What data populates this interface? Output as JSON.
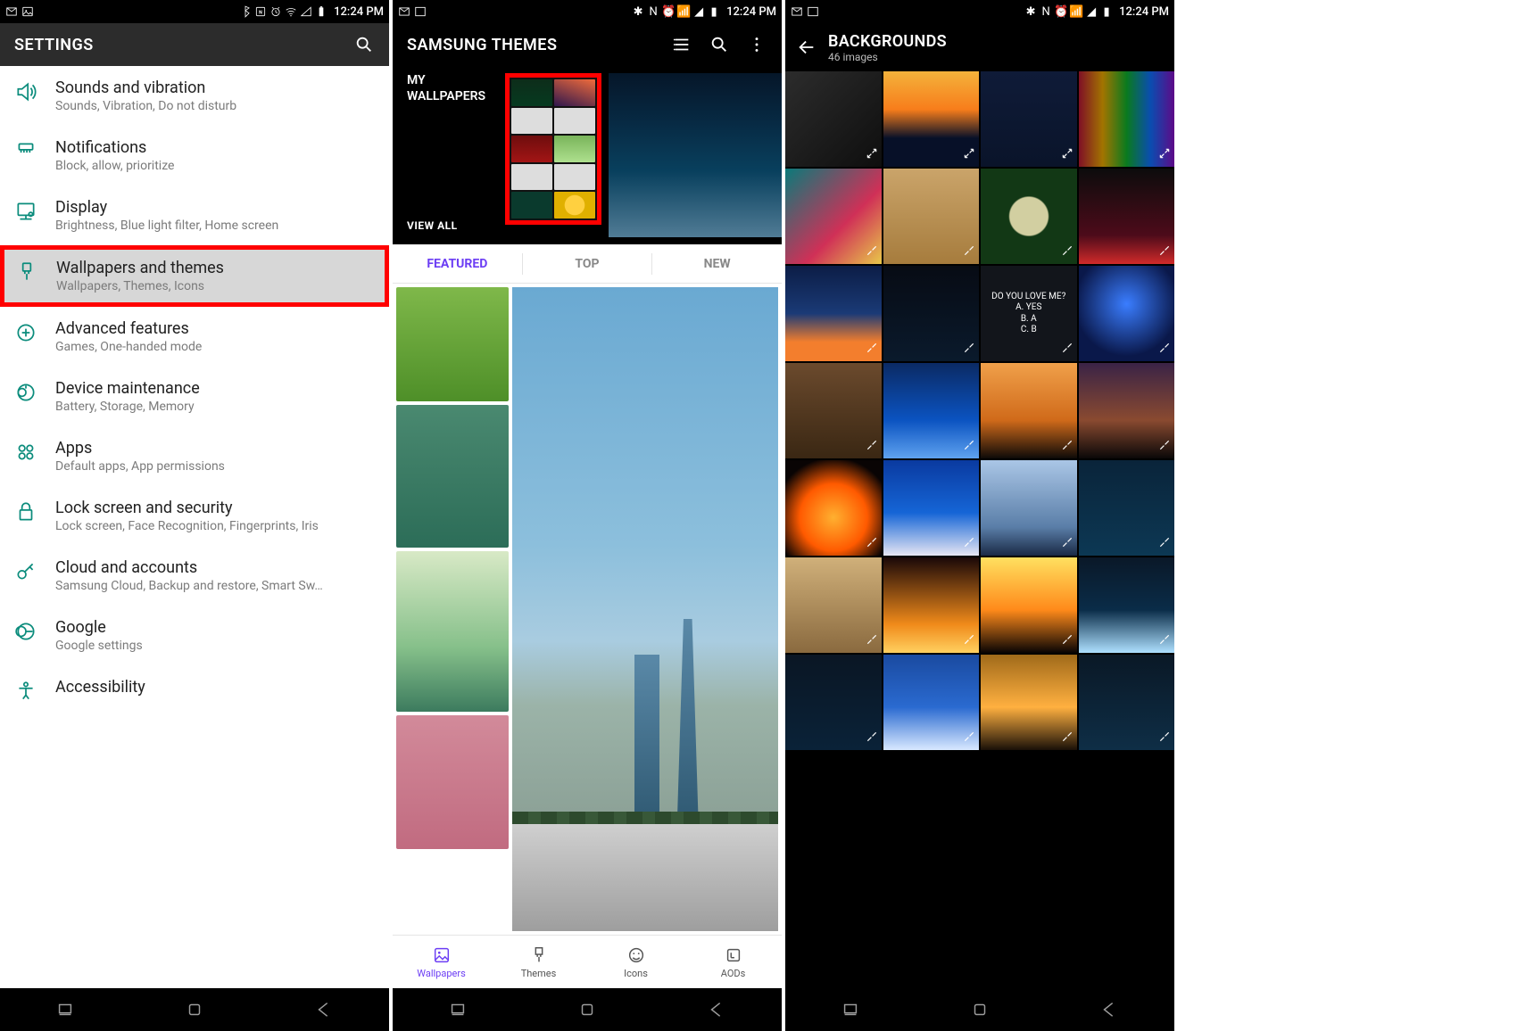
{
  "statusbar": {
    "time": "12:24 PM"
  },
  "phone1": {
    "title": "SETTINGS",
    "items": [
      {
        "title": "Sounds and vibration",
        "sub": "Sounds, Vibration, Do not disturb",
        "icon": "sound"
      },
      {
        "title": "Notifications",
        "sub": "Block, allow, prioritize",
        "icon": "notif"
      },
      {
        "title": "Display",
        "sub": "Brightness, Blue light filter, Home screen",
        "icon": "display"
      },
      {
        "title": "Wallpapers and themes",
        "sub": "Wallpapers, Themes, Icons",
        "icon": "brush",
        "highlight": true
      },
      {
        "title": "Advanced features",
        "sub": "Games, One-handed mode",
        "icon": "plus"
      },
      {
        "title": "Device maintenance",
        "sub": "Battery, Storage, Memory",
        "icon": "maint"
      },
      {
        "title": "Apps",
        "sub": "Default apps, App permissions",
        "icon": "apps"
      },
      {
        "title": "Lock screen and security",
        "sub": "Lock screen, Face Recognition, Fingerprints, Iris",
        "icon": "lock"
      },
      {
        "title": "Cloud and accounts",
        "sub": "Samsung Cloud, Backup and restore, Smart Sw…",
        "icon": "key"
      },
      {
        "title": "Google",
        "sub": "Google settings",
        "icon": "google"
      },
      {
        "title": "Accessibility",
        "sub": "",
        "icon": "access"
      }
    ]
  },
  "phone2": {
    "title": "SAMSUNG THEMES",
    "heroLabel": "MY WALLPAPERS",
    "viewAll": "VIEW ALL",
    "tabs": {
      "featured": "FEATURED",
      "top": "TOP",
      "new": "NEW"
    },
    "bottom": {
      "wallpapers": "Wallpapers",
      "themes": "Themes",
      "icons": "Icons",
      "aods": "AODs"
    }
  },
  "phone3": {
    "title": "BACKGROUNDS",
    "subtitle": "46 images",
    "loveme": "DO YOU LOVE ME?\nA. YES\nB. A\nC. B"
  }
}
